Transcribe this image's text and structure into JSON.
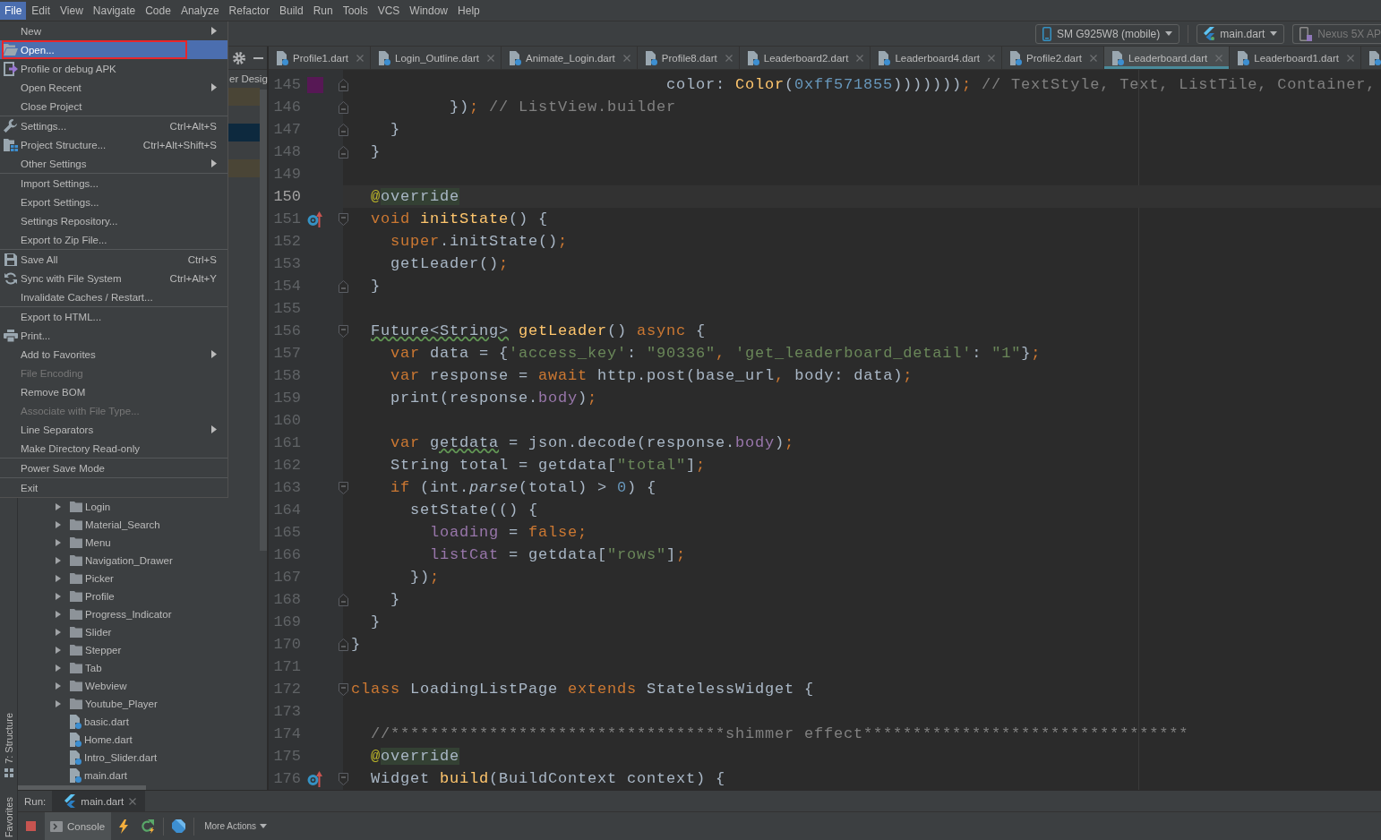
{
  "menu_bar": [
    {
      "label": "File",
      "selected": true
    },
    {
      "label": "Edit",
      "selected": false
    },
    {
      "label": "View",
      "selected": false
    },
    {
      "label": "Navigate",
      "selected": false
    },
    {
      "label": "Code",
      "selected": false
    },
    {
      "label": "Analyze",
      "selected": false
    },
    {
      "label": "Refactor",
      "selected": false
    },
    {
      "label": "Build",
      "selected": false
    },
    {
      "label": "Run",
      "selected": false
    },
    {
      "label": "Tools",
      "selected": false
    },
    {
      "label": "VCS",
      "selected": false
    },
    {
      "label": "Window",
      "selected": false
    },
    {
      "label": "Help",
      "selected": false
    }
  ],
  "file_menu": {
    "sections": [
      {
        "items": [
          {
            "kind": "submenu",
            "label": "New",
            "disabled": false,
            "selected": false,
            "marked": false
          },
          {
            "kind": "open",
            "label": "Open...",
            "disabled": false,
            "selected": true,
            "marked": true
          },
          {
            "kind": "apk",
            "label": "Profile or debug APK",
            "disabled": false,
            "selected": false,
            "marked": false
          },
          {
            "kind": "submenu",
            "label": "Open Recent",
            "disabled": false,
            "selected": false,
            "marked": false
          },
          {
            "kind": "plain",
            "label": "Close Project",
            "disabled": false,
            "selected": false,
            "marked": false
          }
        ]
      },
      {
        "items": [
          {
            "kind": "settings",
            "label": "Settings...",
            "shortcut": "Ctrl+Alt+S",
            "disabled": false,
            "selected": false,
            "marked": false
          },
          {
            "kind": "structure",
            "label": "Project Structure...",
            "shortcut": "Ctrl+Alt+Shift+S",
            "disabled": false,
            "selected": false,
            "marked": false
          },
          {
            "kind": "submenu",
            "label": "Other Settings",
            "disabled": false,
            "selected": false,
            "marked": false
          }
        ]
      },
      {
        "items": [
          {
            "kind": "plain",
            "label": "Import Settings...",
            "disabled": false,
            "selected": false,
            "marked": false
          },
          {
            "kind": "plain",
            "label": "Export Settings...",
            "disabled": false,
            "selected": false,
            "marked": false
          },
          {
            "kind": "plain",
            "label": "Settings Repository...",
            "disabled": false,
            "selected": false,
            "marked": false
          },
          {
            "kind": "plain",
            "label": "Export to Zip File...",
            "disabled": false,
            "selected": false,
            "marked": false
          }
        ]
      },
      {
        "items": [
          {
            "kind": "save",
            "label": "Save All",
            "shortcut": "Ctrl+S",
            "disabled": false,
            "selected": false,
            "marked": false
          },
          {
            "kind": "sync",
            "label": "Sync with File System",
            "shortcut": "Ctrl+Alt+Y",
            "disabled": false,
            "selected": false,
            "marked": false
          },
          {
            "kind": "plain",
            "label": "Invalidate Caches / Restart...",
            "disabled": false,
            "selected": false,
            "marked": false
          }
        ]
      },
      {
        "items": [
          {
            "kind": "plain",
            "label": "Export to HTML...",
            "disabled": false,
            "selected": false,
            "marked": false
          },
          {
            "kind": "print",
            "label": "Print...",
            "disabled": false,
            "selected": false,
            "marked": false
          },
          {
            "kind": "submenu",
            "label": "Add to Favorites",
            "disabled": false,
            "selected": false,
            "marked": false
          },
          {
            "kind": "plain",
            "label": "File Encoding",
            "disabled": true,
            "selected": false,
            "marked": false
          },
          {
            "kind": "plain",
            "label": "Remove BOM",
            "disabled": false,
            "selected": false,
            "marked": false
          },
          {
            "kind": "plain",
            "label": "Associate with File Type...",
            "disabled": true,
            "selected": false,
            "marked": false
          },
          {
            "kind": "submenu",
            "label": "Line Separators",
            "disabled": false,
            "selected": false,
            "marked": false
          },
          {
            "kind": "plain",
            "label": "Make Directory Read-only",
            "disabled": false,
            "selected": false,
            "marked": false
          }
        ]
      },
      {
        "items": [
          {
            "kind": "plain",
            "label": "Power Save Mode",
            "disabled": false,
            "selected": false,
            "marked": false
          }
        ]
      },
      {
        "items": [
          {
            "kind": "plain",
            "label": "Exit",
            "disabled": false,
            "selected": false,
            "marked": false
          }
        ]
      }
    ]
  },
  "toolbar": {
    "device": {
      "label": "SM G925W8 (mobile)"
    },
    "run_config": {
      "label": "main.dart"
    },
    "emulator": {
      "label": "Nexus 5X AP",
      "disabled": true
    }
  },
  "tool_stripe": [
    {
      "kind": "structure",
      "label": "7: Structure"
    },
    {
      "kind": "favorites",
      "label": "Favorites"
    }
  ],
  "project_panel": {
    "covered_rows": [
      {
        "kind": "label",
        "label": "er Desig"
      },
      {
        "kind": "band",
        "color": "#4a4536"
      },
      {
        "kind": "blank"
      },
      {
        "kind": "band",
        "color": "#0d293e"
      },
      {
        "kind": "blank"
      },
      {
        "kind": "band",
        "color": "#4a4536"
      }
    ],
    "tree": [
      {
        "kind": "folder",
        "label": "Login",
        "expanded": false
      },
      {
        "kind": "folder",
        "label": "Material_Search",
        "expanded": false
      },
      {
        "kind": "folder",
        "label": "Menu",
        "expanded": false
      },
      {
        "kind": "folder",
        "label": "Navigation_Drawer",
        "expanded": false
      },
      {
        "kind": "folder",
        "label": "Picker",
        "expanded": false
      },
      {
        "kind": "folder",
        "label": "Profile",
        "expanded": false
      },
      {
        "kind": "folder",
        "label": "Progress_Indicator",
        "expanded": false
      },
      {
        "kind": "folder",
        "label": "Slider",
        "expanded": false
      },
      {
        "kind": "folder",
        "label": "Stepper",
        "expanded": false
      },
      {
        "kind": "folder",
        "label": "Tab",
        "expanded": false
      },
      {
        "kind": "folder",
        "label": "Webview",
        "expanded": false
      },
      {
        "kind": "folder",
        "label": "Youtube_Player",
        "expanded": false
      },
      {
        "kind": "file",
        "label": "basic.dart"
      },
      {
        "kind": "file",
        "label": "Home.dart"
      },
      {
        "kind": "file",
        "label": "Intro_Slider.dart"
      },
      {
        "kind": "file",
        "label": "main.dart"
      }
    ]
  },
  "editor": {
    "tabs": [
      {
        "label": "Profile1.dart",
        "selected": false
      },
      {
        "label": "Login_Outline.dart",
        "selected": false
      },
      {
        "label": "Animate_Login.dart",
        "selected": false
      },
      {
        "label": "Profile8.dart",
        "selected": false
      },
      {
        "label": "Leaderboard2.dart",
        "selected": false
      },
      {
        "label": "Leaderboard4.dart",
        "selected": false
      },
      {
        "label": "Profile2.dart",
        "selected": false
      },
      {
        "label": "Leaderboard.dart",
        "selected": true
      },
      {
        "label": "Leaderboard1.dart",
        "selected": false
      },
      {
        "selected": false
      }
    ],
    "lines": [
      {
        "number": "145",
        "current": false,
        "fold": {
          "kind": "end"
        },
        "gutter": {
          "kind": "swatch",
          "color": "#571855"
        },
        "tokens": [
          {
            "kind": "plain",
            "text": "                                color: "
          },
          {
            "kind": "func",
            "text": "Color"
          },
          {
            "kind": "plain",
            "text": "("
          },
          {
            "kind": "number",
            "text": "0xff571855"
          },
          {
            "kind": "plain",
            "text": ")))))))"
          },
          {
            "kind": "keyword",
            "text": ";"
          },
          {
            "kind": "comment",
            "text": " // TextStyle, Text, ListTile, Container,"
          }
        ]
      },
      {
        "number": "146",
        "current": false,
        "fold": {
          "kind": "end"
        },
        "tokens": [
          {
            "kind": "plain",
            "text": "          })"
          },
          {
            "kind": "keyword",
            "text": ";"
          },
          {
            "kind": "comment",
            "text": " // ListView.builder"
          }
        ]
      },
      {
        "number": "147",
        "current": false,
        "fold": {
          "kind": "end"
        },
        "tokens": [
          {
            "kind": "plain",
            "text": "    }"
          }
        ]
      },
      {
        "number": "148",
        "current": false,
        "fold": {
          "kind": "end"
        },
        "tokens": [
          {
            "kind": "plain",
            "text": "  }"
          }
        ]
      },
      {
        "number": "149",
        "current": false
      },
      {
        "number": "150",
        "current": true,
        "tokens": [
          {
            "kind": "annotation",
            "text": "  @"
          },
          {
            "kind": "usage",
            "text": "override"
          }
        ]
      },
      {
        "number": "151",
        "current": false,
        "fold": {
          "kind": "start"
        },
        "gutter": {
          "kind": "override"
        },
        "tokens": [
          {
            "kind": "keyword",
            "text": "  void "
          },
          {
            "kind": "func",
            "text": "initState"
          },
          {
            "kind": "plain",
            "text": "() {"
          }
        ]
      },
      {
        "number": "152",
        "current": false,
        "tokens": [
          {
            "kind": "keyword",
            "text": "    super"
          },
          {
            "kind": "plain",
            "text": ".initState()"
          },
          {
            "kind": "keyword",
            "text": ";"
          }
        ]
      },
      {
        "number": "153",
        "current": false,
        "tokens": [
          {
            "kind": "plain",
            "text": "    getLeader()"
          },
          {
            "kind": "keyword",
            "text": ";"
          }
        ]
      },
      {
        "number": "154",
        "current": false,
        "fold": {
          "kind": "end"
        },
        "tokens": [
          {
            "kind": "plain",
            "text": "  }"
          }
        ]
      },
      {
        "number": "155",
        "current": false
      },
      {
        "number": "156",
        "current": false,
        "fold": {
          "kind": "start"
        },
        "tokens": [
          {
            "kind": "typo",
            "text": "  Future<String>"
          },
          {
            "kind": "func",
            "text": " getLeader"
          },
          {
            "kind": "plain",
            "text": "() "
          },
          {
            "kind": "keyword",
            "text": "async"
          },
          {
            "kind": "plain",
            "text": " {"
          }
        ]
      },
      {
        "number": "157",
        "current": false,
        "tokens": [
          {
            "kind": "keyword",
            "text": "    var"
          },
          {
            "kind": "plain",
            "text": " data = {"
          },
          {
            "kind": "string",
            "text": "'access_key'"
          },
          {
            "kind": "plain",
            "text": ": "
          },
          {
            "kind": "string",
            "text": "\"90336\""
          },
          {
            "kind": "keyword",
            "text": ", "
          },
          {
            "kind": "string",
            "text": "'get_leaderboard_detail'"
          },
          {
            "kind": "plain",
            "text": ": "
          },
          {
            "kind": "string",
            "text": "\"1\""
          },
          {
            "kind": "plain",
            "text": "}"
          },
          {
            "kind": "keyword",
            "text": ";"
          }
        ]
      },
      {
        "number": "158",
        "current": false,
        "tokens": [
          {
            "kind": "keyword",
            "text": "    var"
          },
          {
            "kind": "plain",
            "text": " response = "
          },
          {
            "kind": "keyword",
            "text": "await"
          },
          {
            "kind": "plain",
            "text": " http.post(base_url"
          },
          {
            "kind": "keyword",
            "text": ", "
          },
          {
            "kind": "plain",
            "text": "body: data)"
          },
          {
            "kind": "keyword",
            "text": ";"
          }
        ]
      },
      {
        "number": "159",
        "current": false,
        "tokens": [
          {
            "kind": "plain",
            "text": "    print(response."
          },
          {
            "kind": "field",
            "text": "body"
          },
          {
            "kind": "plain",
            "text": ")"
          },
          {
            "kind": "keyword",
            "text": ";"
          }
        ]
      },
      {
        "number": "160",
        "current": false
      },
      {
        "number": "161",
        "current": false,
        "tokens": [
          {
            "kind": "keyword",
            "text": "    var "
          },
          {
            "kind": "typo",
            "text": "getdata"
          },
          {
            "kind": "plain",
            "text": " = json.decode(response."
          },
          {
            "kind": "field",
            "text": "body"
          },
          {
            "kind": "plain",
            "text": ")"
          },
          {
            "kind": "keyword",
            "text": ";"
          }
        ]
      },
      {
        "number": "162",
        "current": false,
        "tokens": [
          {
            "kind": "plain",
            "text": "    String total = getdata["
          },
          {
            "kind": "string",
            "text": "\"total\""
          },
          {
            "kind": "plain",
            "text": "]"
          },
          {
            "kind": "keyword",
            "text": ";"
          }
        ]
      },
      {
        "number": "163",
        "current": false,
        "fold": {
          "kind": "start"
        },
        "tokens": [
          {
            "kind": "keyword",
            "text": "    if"
          },
          {
            "kind": "plain",
            "text": " (int."
          },
          {
            "kind": "static",
            "text": "parse"
          },
          {
            "kind": "plain",
            "text": "(total) > "
          },
          {
            "kind": "number",
            "text": "0"
          },
          {
            "kind": "plain",
            "text": ") {"
          }
        ]
      },
      {
        "number": "164",
        "current": false,
        "tokens": [
          {
            "kind": "plain",
            "text": "      setState(() {"
          }
        ]
      },
      {
        "number": "165",
        "current": false,
        "tokens": [
          {
            "kind": "field",
            "text": "        loading"
          },
          {
            "kind": "plain",
            "text": " = "
          },
          {
            "kind": "keyword",
            "text": "false"
          },
          {
            "kind": "keyword",
            "text": ";"
          }
        ]
      },
      {
        "number": "166",
        "current": false,
        "tokens": [
          {
            "kind": "field",
            "text": "        listCat"
          },
          {
            "kind": "plain",
            "text": " = getdata["
          },
          {
            "kind": "string",
            "text": "\"rows\""
          },
          {
            "kind": "plain",
            "text": "]"
          },
          {
            "kind": "keyword",
            "text": ";"
          }
        ]
      },
      {
        "number": "167",
        "current": false,
        "tokens": [
          {
            "kind": "plain",
            "text": "      })"
          },
          {
            "kind": "keyword",
            "text": ";"
          }
        ]
      },
      {
        "number": "168",
        "current": false,
        "fold": {
          "kind": "end"
        },
        "tokens": [
          {
            "kind": "plain",
            "text": "    }"
          }
        ]
      },
      {
        "number": "169",
        "current": false,
        "tokens": [
          {
            "kind": "plain",
            "text": "  }"
          }
        ]
      },
      {
        "number": "170",
        "current": false,
        "fold": {
          "kind": "end"
        },
        "tokens": [
          {
            "kind": "plain",
            "text": "}"
          }
        ]
      },
      {
        "number": "171",
        "current": false
      },
      {
        "number": "172",
        "current": false,
        "fold": {
          "kind": "start"
        },
        "tokens": [
          {
            "kind": "keyword",
            "text": "class"
          },
          {
            "kind": "plain",
            "text": " LoadingListPage "
          },
          {
            "kind": "keyword",
            "text": "extends"
          },
          {
            "kind": "plain",
            "text": " StatelessWidget {"
          }
        ]
      },
      {
        "number": "173",
        "current": false
      },
      {
        "number": "174",
        "current": false,
        "tokens": [
          {
            "kind": "comment",
            "text": "  //**********************************shimmer effect*********************************"
          }
        ]
      },
      {
        "number": "175",
        "current": false,
        "tokens": [
          {
            "kind": "annotation",
            "text": "  @"
          },
          {
            "kind": "usage",
            "text": "override"
          }
        ]
      },
      {
        "number": "176",
        "current": false,
        "fold": {
          "kind": "start"
        },
        "gutter": {
          "kind": "override"
        },
        "tokens": [
          {
            "kind": "plain",
            "text": "  Widget "
          },
          {
            "kind": "func",
            "text": "build"
          },
          {
            "kind": "plain",
            "text": "(BuildContext context) {"
          }
        ]
      }
    ]
  },
  "run_panel": {
    "title": "Run:",
    "tabs": [
      {
        "label": "main.dart",
        "selected": true
      }
    ],
    "console": {
      "label": "Console",
      "selected": true
    },
    "more_actions": {
      "label": "More Actions"
    }
  }
}
